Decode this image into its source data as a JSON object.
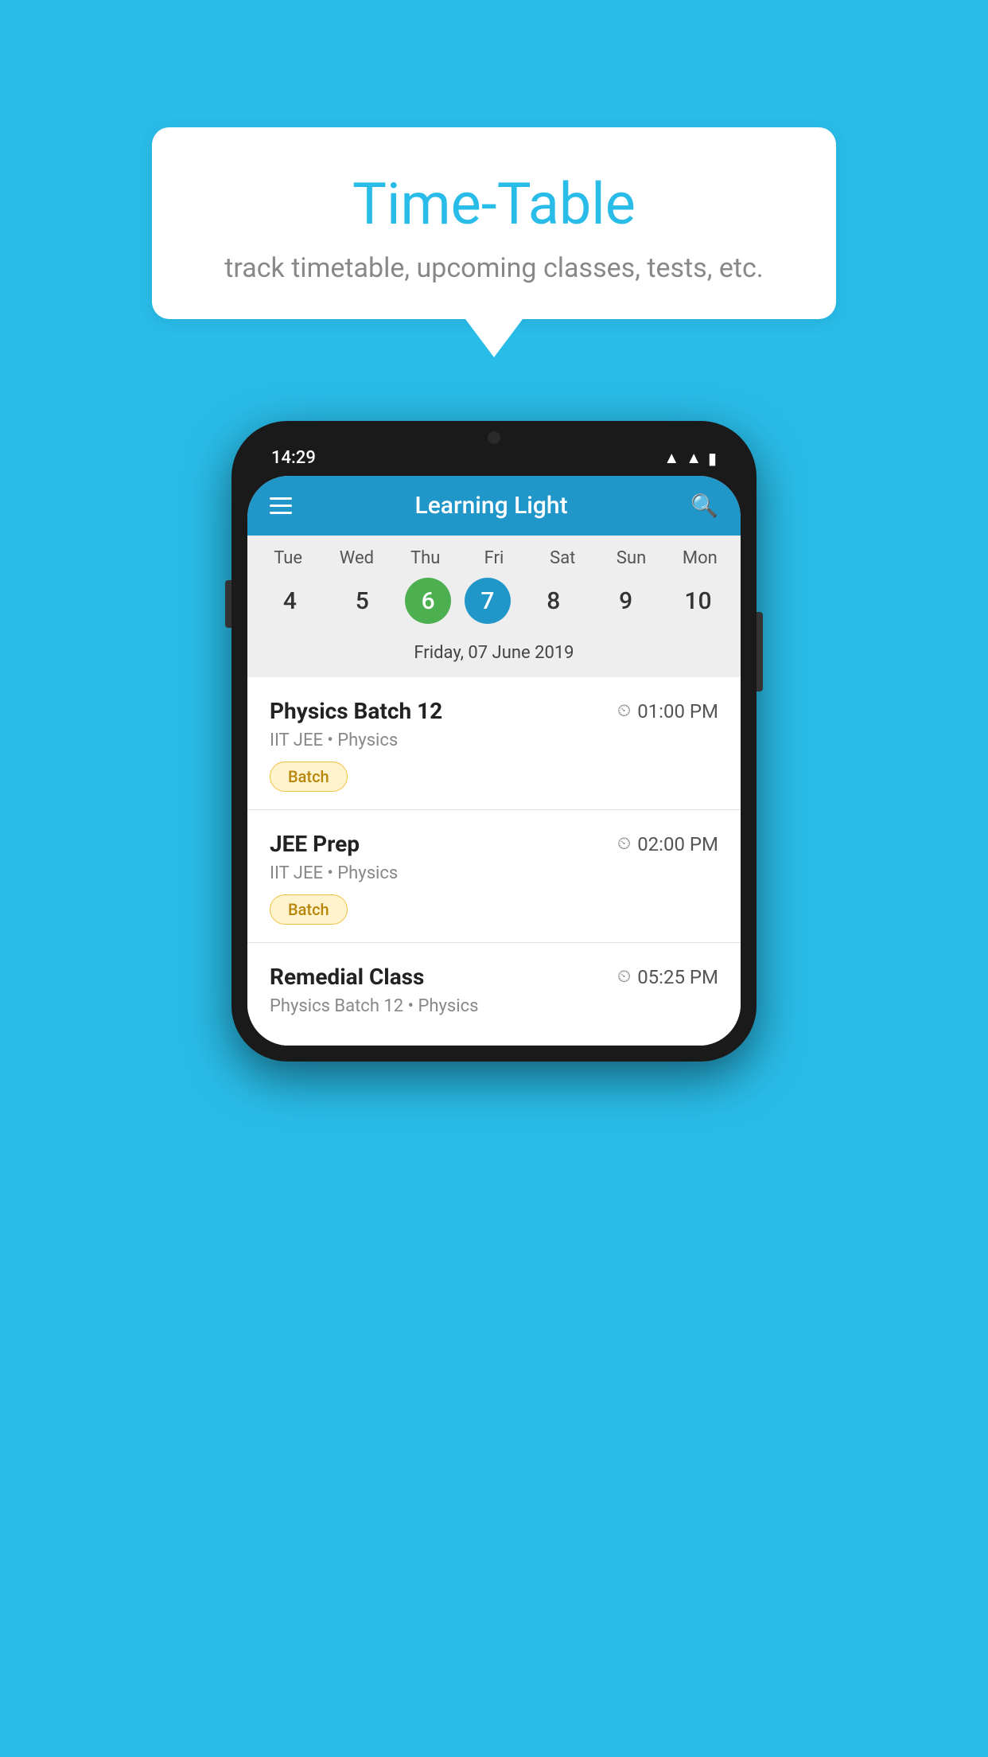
{
  "background_color": "#29bce8",
  "speech_bubble": {
    "title": "Time-Table",
    "subtitle": "track timetable, upcoming classes, tests, etc."
  },
  "phone": {
    "status_bar": {
      "time": "14:29",
      "icons": [
        "▲",
        "▲",
        "▮"
      ]
    },
    "app_header": {
      "title": "Learning Light"
    },
    "calendar": {
      "days": [
        "Tue",
        "Wed",
        "Thu",
        "Fri",
        "Sat",
        "Sun",
        "Mon"
      ],
      "dates": [
        "4",
        "5",
        "6",
        "7",
        "8",
        "9",
        "10"
      ],
      "today_index": 2,
      "selected_index": 3,
      "selected_label": "Friday, 07 June 2019"
    },
    "schedule_items": [
      {
        "name": "Physics Batch 12",
        "time": "01:00 PM",
        "subtitle": "IIT JEE • Physics",
        "badge": "Batch"
      },
      {
        "name": "JEE Prep",
        "time": "02:00 PM",
        "subtitle": "IIT JEE • Physics",
        "badge": "Batch"
      },
      {
        "name": "Remedial Class",
        "time": "05:25 PM",
        "subtitle": "Physics Batch 12 • Physics",
        "badge": null
      }
    ]
  }
}
